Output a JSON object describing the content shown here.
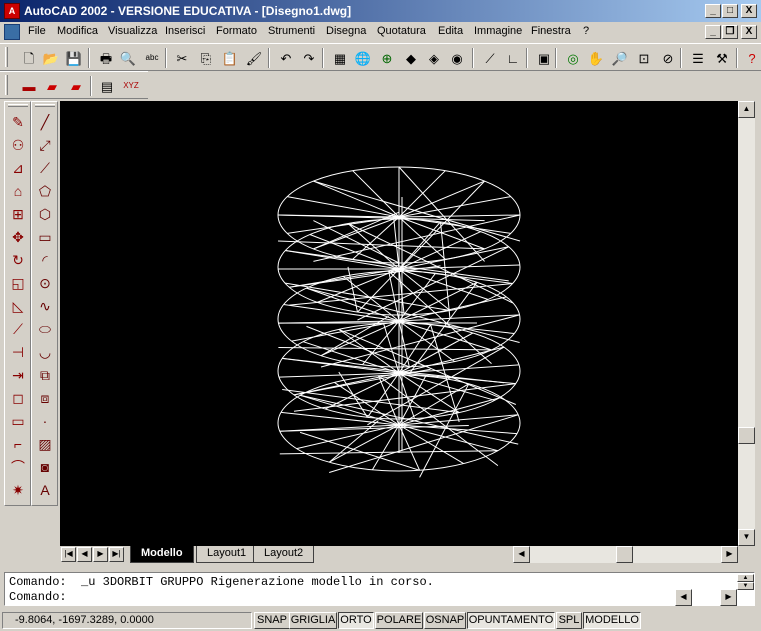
{
  "window": {
    "title": "AutoCAD 2002 - VERSIONE EDUCATIVA - [Disegno1.dwg]",
    "caption_buttons": {
      "minimize": "_",
      "maximize": "□",
      "close": "X"
    }
  },
  "menubar": {
    "items": [
      "File",
      "Modifica",
      "Visualizza",
      "Inserisci",
      "Formato",
      "Strumenti",
      "Disegna",
      "Quotatura",
      "Edita",
      "Immagine",
      "Finestra",
      "?"
    ],
    "doc_buttons": {
      "minimize": "_",
      "restore": "❐",
      "close": "X"
    }
  },
  "standard_toolbar": {
    "icons": [
      {
        "name": "new-icon",
        "glyph": "🗋"
      },
      {
        "name": "open-icon",
        "glyph": "📂"
      },
      {
        "name": "save-icon",
        "glyph": "💾"
      },
      {
        "name": "print-icon",
        "glyph": "🖶"
      },
      {
        "name": "print-preview-icon",
        "glyph": "🔍"
      },
      {
        "name": "spellcheck-icon",
        "glyph": "abc"
      },
      {
        "name": "cut-icon",
        "glyph": "✂"
      },
      {
        "name": "copy-icon",
        "glyph": "⎘"
      },
      {
        "name": "paste-icon",
        "glyph": "📋"
      },
      {
        "name": "match-properties-icon",
        "glyph": "🖌"
      },
      {
        "name": "undo-icon",
        "glyph": "↶"
      },
      {
        "name": "redo-icon",
        "glyph": "↷"
      },
      {
        "name": "design-center-icon",
        "glyph": "▦"
      },
      {
        "name": "hyperlink-icon",
        "glyph": "🌐"
      },
      {
        "name": "web-icon",
        "glyph": "⊕"
      },
      {
        "name": "today-icon",
        "glyph": "◆"
      },
      {
        "name": "publish-web-icon",
        "glyph": "◈"
      },
      {
        "name": "etransmit-icon",
        "glyph": "◉"
      },
      {
        "name": "distance-icon",
        "glyph": "⟋"
      },
      {
        "name": "ucs-icon",
        "glyph": "∟"
      },
      {
        "name": "named-views-icon",
        "glyph": "▣"
      },
      {
        "name": "orbit-icon",
        "glyph": "◎"
      },
      {
        "name": "pan-icon",
        "glyph": "✋"
      },
      {
        "name": "zoom-realtime-icon",
        "glyph": "🔎"
      },
      {
        "name": "zoom-window-icon",
        "glyph": "⊡"
      },
      {
        "name": "zoom-previous-icon",
        "glyph": "⊘"
      },
      {
        "name": "properties-icon",
        "glyph": "☰"
      },
      {
        "name": "tool-palette-icon",
        "glyph": "⚒"
      },
      {
        "name": "help-icon",
        "glyph": "?"
      }
    ]
  },
  "secondary_toolbar": {
    "icons": [
      {
        "name": "layer-tool-1-icon",
        "glyph": "▬"
      },
      {
        "name": "layer-tool-2-icon",
        "glyph": "▰"
      },
      {
        "name": "layer-tool-3-icon",
        "glyph": "▰"
      },
      {
        "name": "text-list-icon",
        "glyph": "▤"
      },
      {
        "name": "xyz-icon",
        "glyph": "XYZ"
      }
    ]
  },
  "modify_toolbar": {
    "icons": [
      {
        "name": "erase-icon",
        "glyph": "✎"
      },
      {
        "name": "copy-object-icon",
        "glyph": "⚇"
      },
      {
        "name": "mirror-icon",
        "glyph": "⊿"
      },
      {
        "name": "offset-icon",
        "glyph": "⌂"
      },
      {
        "name": "array-icon",
        "glyph": "⊞"
      },
      {
        "name": "move-icon",
        "glyph": "✥"
      },
      {
        "name": "rotate-icon",
        "glyph": "↻"
      },
      {
        "name": "scale-icon",
        "glyph": "◱"
      },
      {
        "name": "stretch-icon",
        "glyph": "◺"
      },
      {
        "name": "lengthen-icon",
        "glyph": "⟋"
      },
      {
        "name": "trim-icon",
        "glyph": "⊣"
      },
      {
        "name": "extend-icon",
        "glyph": "⇥"
      },
      {
        "name": "break-point-icon",
        "glyph": "◻"
      },
      {
        "name": "break-icon",
        "glyph": "▭"
      },
      {
        "name": "chamfer-icon",
        "glyph": "⌐"
      },
      {
        "name": "fillet-icon",
        "glyph": "⌒"
      },
      {
        "name": "explode-icon",
        "glyph": "✷"
      }
    ]
  },
  "draw_toolbar": {
    "icons": [
      {
        "name": "line-icon",
        "glyph": "╱"
      },
      {
        "name": "construction-line-icon",
        "glyph": "⤢"
      },
      {
        "name": "polyline-icon",
        "glyph": "⟋"
      },
      {
        "name": "polygon-icon",
        "glyph": "⬠"
      },
      {
        "name": "polygon-shape-icon",
        "glyph": "⬡"
      },
      {
        "name": "rectangle-icon",
        "glyph": "▭"
      },
      {
        "name": "arc-icon",
        "glyph": "◜"
      },
      {
        "name": "circle-icon",
        "glyph": "⊙"
      },
      {
        "name": "spline-icon",
        "glyph": "∿"
      },
      {
        "name": "ellipse-icon",
        "glyph": "⬭"
      },
      {
        "name": "ellipse-arc-icon",
        "glyph": "◡"
      },
      {
        "name": "insert-block-icon",
        "glyph": "⧉"
      },
      {
        "name": "make-block-icon",
        "glyph": "⧈"
      },
      {
        "name": "point-icon",
        "glyph": "·"
      },
      {
        "name": "hatch-icon",
        "glyph": "▨"
      },
      {
        "name": "region-icon",
        "glyph": "◙"
      },
      {
        "name": "multiline-text-icon",
        "glyph": "A"
      }
    ]
  },
  "layout_tabs": [
    "Modello",
    "Layout1",
    "Layout2"
  ],
  "command": {
    "line1": "Comando:  _u 3DORBIT GRUPPO Rigenerazione modello in corso.",
    "line2": "Comando:"
  },
  "status": {
    "coords": "-9.8064,  -1697.3289, 0.0000",
    "buttons": [
      {
        "label": "SNAP",
        "on": false
      },
      {
        "label": "GRIGLIA",
        "on": false
      },
      {
        "label": "ORTO",
        "on": true
      },
      {
        "label": "POLARE",
        "on": false
      },
      {
        "label": "OSNAP",
        "on": false
      },
      {
        "label": "OPUNTAMENTO",
        "on": true
      },
      {
        "label": "SPL",
        "on": false
      },
      {
        "label": "MODELLO",
        "on": true
      }
    ]
  },
  "drawing": {
    "discs": 5,
    "spokes": 16
  }
}
